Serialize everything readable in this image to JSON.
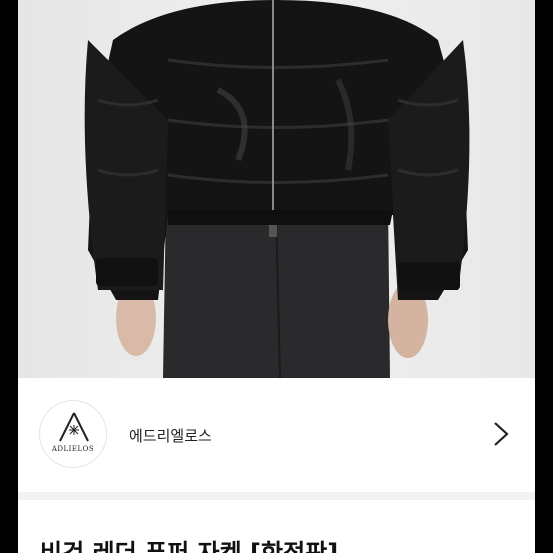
{
  "product": {
    "title": "비건 레더 푸퍼 자켓 [한정판]",
    "image": "black-vegan-leather-puffer-jacket-photo"
  },
  "seller": {
    "name": "에드리엘로스",
    "logo_text": "ADLIELOS",
    "logo_icon": "star-burst-logo"
  },
  "icons": {
    "next": "chevron-right-icon"
  },
  "colors": {
    "background": "#000000",
    "card": "#ffffff",
    "divider": "#f2f2f2",
    "text": "#222222"
  }
}
